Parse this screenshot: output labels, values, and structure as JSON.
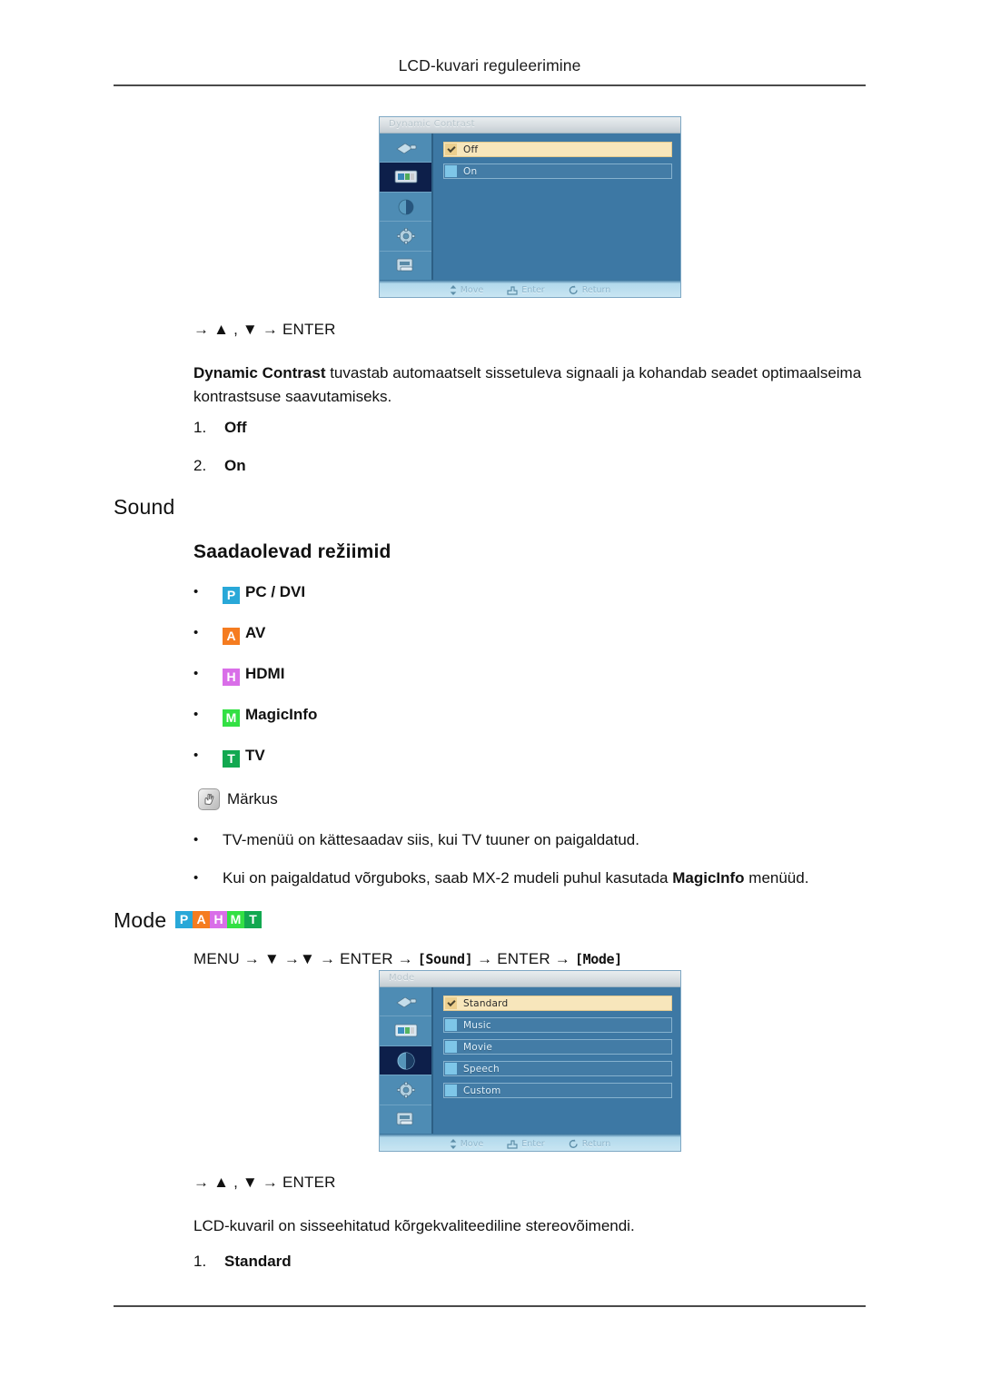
{
  "header": {
    "title": "LCD-kuvari reguleerimine"
  },
  "osd_dynamic_contrast": {
    "title": "Dynamic Contrast",
    "sidebar_icons": [
      "input-jack-icon",
      "picture-monitor-icon",
      "sound-speaker-icon",
      "setup-gear-icon",
      "multi-control-icon"
    ],
    "selected_sidebar_index": 1,
    "options": [
      {
        "label": "Off",
        "selected": true
      },
      {
        "label": "On",
        "selected": false
      }
    ],
    "footer": [
      {
        "icon": "move-updown-icon",
        "label": "Move"
      },
      {
        "icon": "enter-hand-icon",
        "label": "Enter"
      },
      {
        "icon": "return-loop-icon",
        "label": "Return"
      }
    ]
  },
  "nav_contrast": {
    "text": "→ ▲ , ▼ → ENTER"
  },
  "dynamic_contrast_desc": {
    "bold_lead": "Dynamic Contrast",
    "rest": " tuvastab automaatselt sissetuleva signaali ja kohandab seadet optimaalseima kontrastsuse saavutamiseks."
  },
  "dynamic_contrast_items": [
    {
      "num": "1.",
      "label": "Off"
    },
    {
      "num": "2.",
      "label": "On"
    }
  ],
  "sound_section": {
    "heading": "Sound",
    "subheading": "Saadaolevad režiimid"
  },
  "available_modes": [
    {
      "badge": "P",
      "color": "#29a8d8",
      "label": "PC / DVI"
    },
    {
      "badge": "A",
      "color": "#f57c20",
      "label": "AV"
    },
    {
      "badge": "H",
      "color": "#d96ee8",
      "label": "HDMI"
    },
    {
      "badge": "M",
      "color": "#33e044",
      "label": "MagicInfo"
    },
    {
      "badge": "T",
      "color": "#12a850",
      "label": "TV"
    }
  ],
  "note": {
    "icon": "note-hand-icon",
    "title": "Märkus",
    "bullets": [
      {
        "text": "TV-menüü on kättesaadav siis, kui TV tuuner on paigaldatud."
      },
      {
        "pre": "Kui on paigaldatud võrguboks, saab MX-2 mudeli puhul kasutada ",
        "bold": "MagicInfo",
        "post": " menüüd."
      }
    ]
  },
  "mode_section": {
    "heading": "Mode",
    "badges": [
      {
        "badge": "P",
        "color": "#29a8d8"
      },
      {
        "badge": "A",
        "color": "#f57c20"
      },
      {
        "badge": "H",
        "color": "#d96ee8"
      },
      {
        "badge": "M",
        "color": "#33e044"
      },
      {
        "badge": "T",
        "color": "#12a850"
      }
    ],
    "nav": {
      "p1": "MENU → ▼ →▼ → ENTER → ",
      "box1": "[Sound]",
      "p2": " → ENTER → ",
      "box2": "[Mode]"
    }
  },
  "osd_mode": {
    "title": "Mode",
    "sidebar_icons": [
      "input-jack-icon",
      "picture-monitor-icon",
      "sound-speaker-icon",
      "setup-gear-icon",
      "multi-control-icon"
    ],
    "selected_sidebar_index": 2,
    "options": [
      {
        "label": "Standard",
        "selected": true
      },
      {
        "label": "Music",
        "selected": false
      },
      {
        "label": "Movie",
        "selected": false
      },
      {
        "label": "Speech",
        "selected": false
      },
      {
        "label": "Custom",
        "selected": false
      }
    ],
    "footer": [
      {
        "icon": "move-updown-icon",
        "label": "Move"
      },
      {
        "icon": "enter-hand-icon",
        "label": "Enter"
      },
      {
        "icon": "return-loop-icon",
        "label": "Return"
      }
    ]
  },
  "nav_mode": {
    "text": "→ ▲ , ▼ → ENTER"
  },
  "mode_desc": {
    "text": "LCD-kuvaril on sisseehitatud kõrgekvaliteediline stereovõimendi."
  },
  "mode_items": [
    {
      "num": "1.",
      "label": "Standard"
    }
  ]
}
